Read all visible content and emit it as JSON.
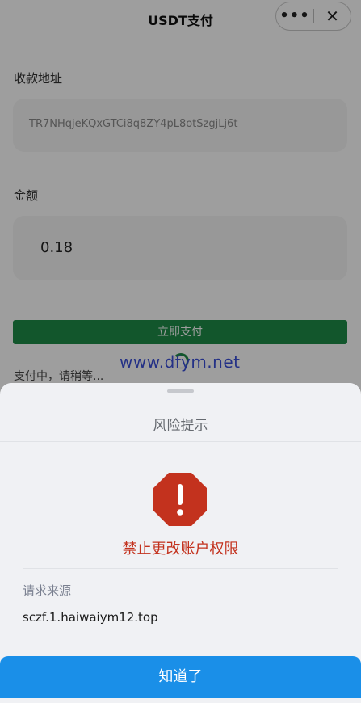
{
  "header": {
    "title": "USDT支付",
    "more_icon": "more-dots-icon",
    "close_icon": "close-icon",
    "more_glyph": "•••",
    "close_glyph": "✕"
  },
  "form": {
    "address_label": "收款地址",
    "address_value": "TR7NHqjeKQxGTCi8q8ZY4pL8otSzgjLj6t",
    "amount_label": "金额",
    "amount_value": "0.18",
    "pay_button": "立即支付",
    "status_text": "支付中，请稍等..."
  },
  "watermark": "www.dfym.net",
  "sheet": {
    "title": "风险提示",
    "warning_icon": "warning-octagon-icon",
    "warning_text": "禁止更改账户权限",
    "source_label": "请求来源",
    "source_value": "sczf.1.haiwaiym12.top",
    "ok_button": "知道了"
  },
  "colors": {
    "pay_button": "#1e8b47",
    "warning": "#c3321e",
    "ok_button": "#1a8fe8",
    "sheet_bg": "#f0f1f4"
  }
}
